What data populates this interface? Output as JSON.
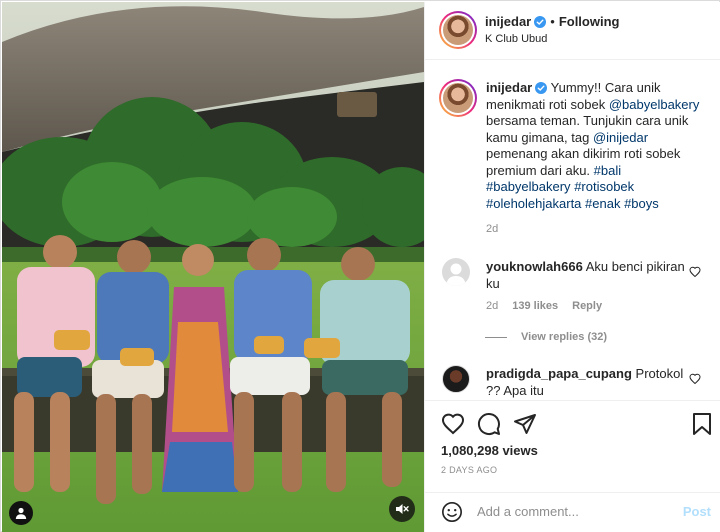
{
  "colors": {
    "accent": "#0095f6",
    "link": "#00376b",
    "muted": "#8e8e8e",
    "verified": "#3897f0"
  },
  "post": {
    "username": "inijedar",
    "follow_status": "Following",
    "separator": "•",
    "location": "K Club Ubud"
  },
  "caption": {
    "username": "inijedar",
    "text_1": "Yummy!! Cara unik menikmati roti sobek ",
    "mention_1": "@babyelbakery",
    "text_2": " bersama teman. Tunjukin cara unik kamu gimana, tag ",
    "mention_2": "@inijedar",
    "text_3": " pemenang akan dikirim roti sobek premium dari aku. ",
    "hashtags": [
      "#bali",
      "#babyelbakery",
      "#rotisobek",
      "#oleholehjakarta",
      "#enak",
      "#boys"
    ],
    "age": "2d"
  },
  "comments": [
    {
      "username": "youknowlah666",
      "text": "Aku benci pikiran ku",
      "age": "2d",
      "likes": "139 likes",
      "reply_label": "Reply",
      "view_replies": "View replies (32)",
      "avatar_icon": "default-avatar-icon"
    },
    {
      "username": "pradigda_papa_cupang",
      "text": "Protokol ?? Apa itu",
      "avatar_icon": "user-photo"
    }
  ],
  "stats": {
    "views": "1,080,298 views",
    "posted": "2 DAYS AGO"
  },
  "composer": {
    "placeholder": "Add a comment...",
    "post_label": "Post"
  },
  "icons": {
    "like": "heart-icon",
    "comment": "comment-icon",
    "share": "share-icon",
    "save": "bookmark-icon",
    "emoji": "emoji-icon",
    "mute": "speaker-muted-icon",
    "tag": "user-tag-icon"
  }
}
